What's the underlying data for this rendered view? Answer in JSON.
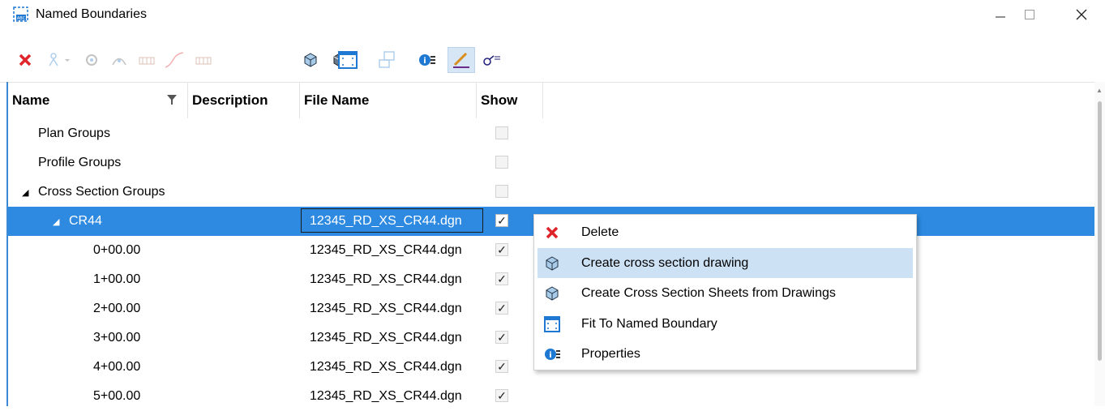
{
  "window": {
    "title": "Named Boundaries",
    "controls": {
      "minimize": "—",
      "maximize": "☐",
      "close": "✕"
    }
  },
  "toolbar": {
    "buttons": [
      {
        "name": "delete",
        "icon": "red-x-icon",
        "enabled": true
      },
      {
        "name": "create-named-boundary",
        "icon": "person-dropdown-icon",
        "enabled": false
      },
      {
        "name": "tool-3",
        "icon": "gear-icon",
        "enabled": false
      },
      {
        "name": "tool-4",
        "icon": "arc-icon",
        "enabled": false
      },
      {
        "name": "tool-5",
        "icon": "grid-icon",
        "enabled": false
      },
      {
        "name": "tool-6",
        "icon": "profile-curve-icon",
        "enabled": false
      },
      {
        "name": "tool-7",
        "icon": "grid-icon",
        "enabled": false
      },
      {
        "name": "create-cross-section",
        "icon": "cube-icon",
        "enabled": true
      },
      {
        "name": "fit-to-boundary",
        "icon": "fit-view-icon",
        "enabled": true
      },
      {
        "name": "tool-10",
        "icon": "stack-icon",
        "enabled": false
      },
      {
        "name": "properties",
        "icon": "properties-icon",
        "enabled": true
      },
      {
        "name": "draw",
        "icon": "pencil-icon",
        "enabled": true,
        "active": true
      },
      {
        "name": "settings",
        "icon": "settings-key-icon",
        "enabled": true
      }
    ]
  },
  "grid": {
    "columns": [
      "Name",
      "Description",
      "File Name",
      "Show"
    ],
    "rows": [
      {
        "name": "Plan Groups",
        "description": "",
        "file": "",
        "show": false,
        "level": 0,
        "expander": ""
      },
      {
        "name": "Profile Groups",
        "description": "",
        "file": "",
        "show": false,
        "level": 0,
        "expander": ""
      },
      {
        "name": "Cross Section Groups",
        "description": "",
        "file": "",
        "show": false,
        "level": 0,
        "expander": "◢"
      },
      {
        "name": "CR44",
        "description": "",
        "file": "12345_RD_XS_CR44.dgn",
        "show": true,
        "level": 1,
        "expander": "◢",
        "selected": true
      },
      {
        "name": "0+00.00",
        "description": "",
        "file": "12345_RD_XS_CR44.dgn",
        "show": true,
        "level": 2,
        "expander": ""
      },
      {
        "name": "1+00.00",
        "description": "",
        "file": "12345_RD_XS_CR44.dgn",
        "show": true,
        "level": 2,
        "expander": ""
      },
      {
        "name": "2+00.00",
        "description": "",
        "file": "12345_RD_XS_CR44.dgn",
        "show": true,
        "level": 2,
        "expander": ""
      },
      {
        "name": "3+00.00",
        "description": "",
        "file": "12345_RD_XS_CR44.dgn",
        "show": true,
        "level": 2,
        "expander": ""
      },
      {
        "name": "4+00.00",
        "description": "",
        "file": "12345_RD_XS_CR44.dgn",
        "show": true,
        "level": 2,
        "expander": ""
      },
      {
        "name": "5+00.00",
        "description": "",
        "file": "12345_RD_XS_CR44.dgn",
        "show": true,
        "level": 2,
        "expander": ""
      }
    ]
  },
  "context_menu": {
    "items": [
      {
        "label": "Delete",
        "icon": "red-x-icon"
      },
      {
        "label": "Create cross section drawing",
        "icon": "cube-icon",
        "hover": true
      },
      {
        "label": "Create Cross Section Sheets from Drawings",
        "icon": "cube-icon"
      },
      {
        "label": "Fit To Named Boundary",
        "icon": "fit-view-icon"
      },
      {
        "label": "Properties",
        "icon": "properties-icon"
      }
    ]
  },
  "colors": {
    "selection": "#2d8ae0",
    "menu_hover": "#cde1f5",
    "delete_red": "#e0242b",
    "icon_blue": "#1f78d1"
  }
}
